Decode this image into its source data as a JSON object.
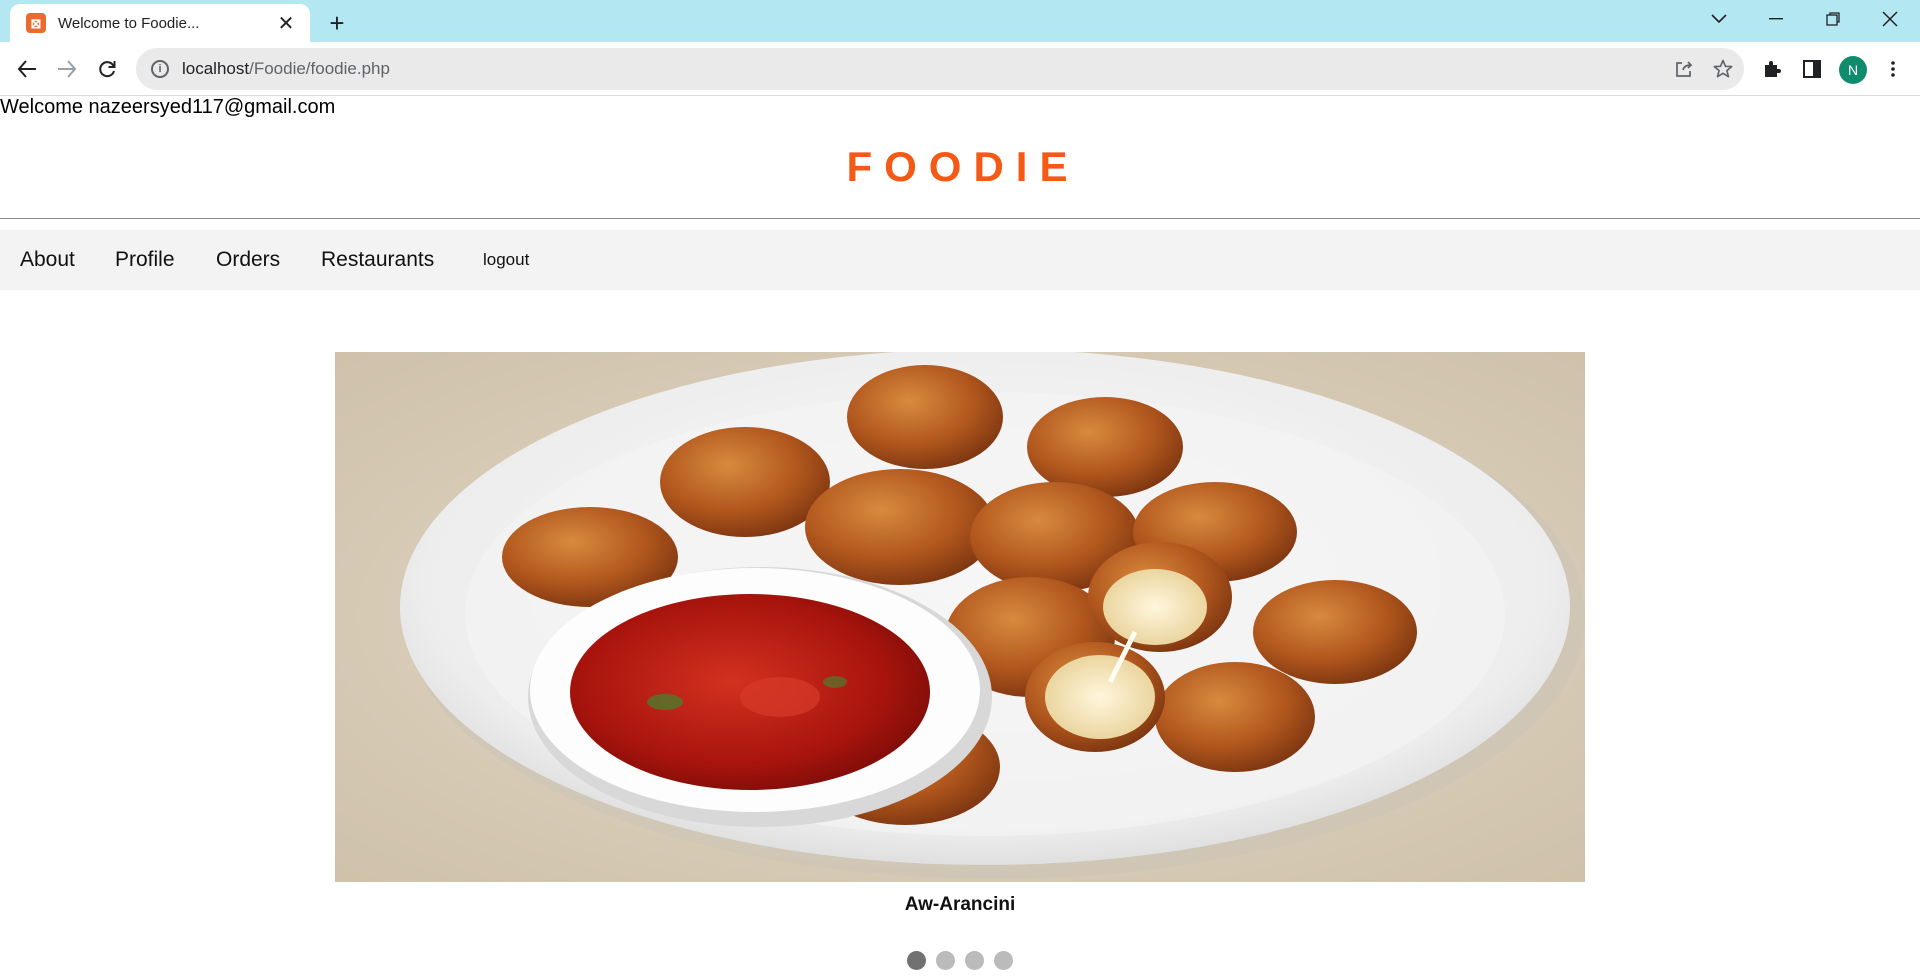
{
  "browser": {
    "tab_title": "Welcome to Foodie...",
    "url_host": "localhost",
    "url_path": "/Foodie/foodie.php",
    "profile_initial": "N",
    "favicon_glyph": "⊠"
  },
  "page": {
    "welcome_text": "Welcome nazeersyed117@gmail.com",
    "brand": "FOODIE",
    "brand_color": "#f45a16",
    "nav": {
      "about": "About",
      "profile": "Profile",
      "orders": "Orders",
      "restaurants": "Restaurants",
      "logout": "logout"
    },
    "carousel": {
      "caption": "Aw-Arancini",
      "total_slides": 4,
      "active_index": 0
    }
  }
}
